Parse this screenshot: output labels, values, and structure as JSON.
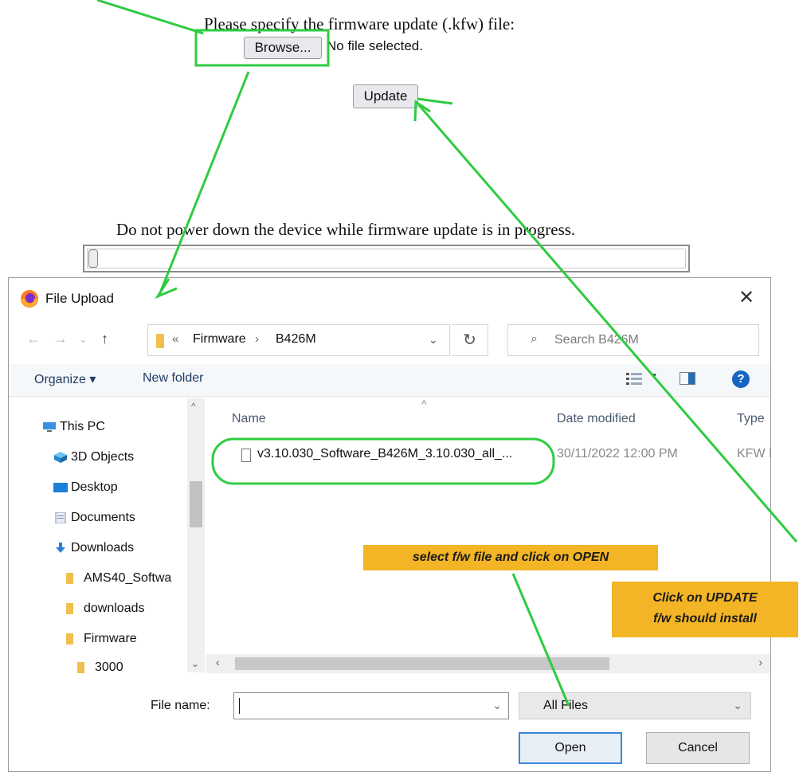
{
  "web": {
    "prompt": "Please specify the firmware update (.kfw) file:",
    "browse_label": "Browse...",
    "no_file": "No file selected.",
    "update_label": "Update",
    "warning": "Do not power down the device while firmware update is in progress.",
    "progress_percent": 0
  },
  "dialog": {
    "title": "File Upload",
    "close_glyph": "✕",
    "breadcrumb": [
      "Firmware",
      "B426M"
    ],
    "search_placeholder": "Search B426M",
    "organize_label": "Organize ▾",
    "new_folder_label": "New folder",
    "nav_items": [
      {
        "label": "This PC",
        "icon": "pc-icon"
      },
      {
        "label": "3D Objects",
        "icon": "cube-icon"
      },
      {
        "label": "Desktop",
        "icon": "desktop-icon"
      },
      {
        "label": "Documents",
        "icon": "document-icon"
      },
      {
        "label": "Downloads",
        "icon": "download-icon"
      },
      {
        "label": "AMS40_Softwa",
        "icon": "folder-icon"
      },
      {
        "label": "downloads",
        "icon": "folder-icon"
      },
      {
        "label": "Firmware",
        "icon": "folder-icon"
      },
      {
        "label": "3000",
        "icon": "folder-icon"
      }
    ],
    "columns": {
      "name": "Name",
      "date": "Date modified",
      "type": "Type"
    },
    "files": [
      {
        "name": "v3.10.030_Software_B426M_3.10.030_all_...",
        "date": "30/11/2022 12:00 PM",
        "type": "KFW I"
      }
    ],
    "file_name_label": "File name:",
    "file_name_value": "",
    "filter_value": "All Files",
    "open_label": "Open",
    "cancel_label": "Cancel"
  },
  "annotations": {
    "note_open": "select f/w file and click on OPEN",
    "note_update_line1": "Click  on UPDATE",
    "note_update_line2": "f/w should install"
  },
  "colors": {
    "annotation_green": "#2ecc40",
    "note_yellow": "#f3b425",
    "accent_blue": "#1765c2"
  }
}
